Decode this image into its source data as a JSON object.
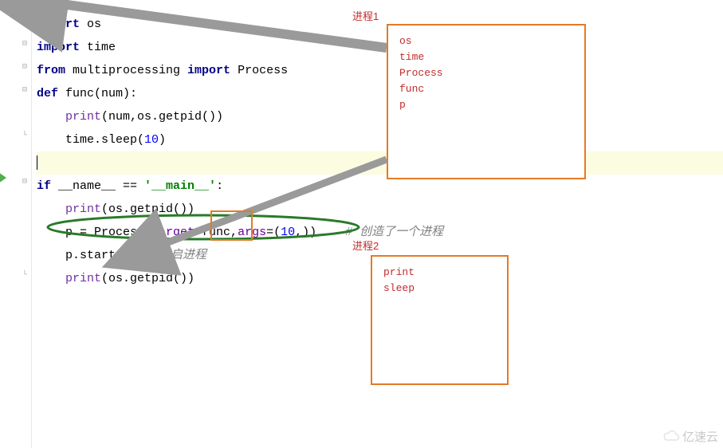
{
  "code": {
    "l1a": "import",
    "l1b": " os",
    "l2a": "import",
    "l2b": " time",
    "l3a": "from",
    "l3b": " multiprocessing ",
    "l3c": "import",
    "l3d": " Process",
    "l4a": "def",
    "l4b": " func(num):",
    "l5a": "    ",
    "l5b": "print",
    "l5c": "(num,os.getpid())",
    "l6a": "    time.sleep(",
    "l6b": "10",
    "l6c": ")",
    "l8a": "if",
    "l8b": " __name__ == ",
    "l8c": "'__main__'",
    "l8d": ":",
    "l9a": "    ",
    "l9b": "print",
    "l9c": "(os.getpid())",
    "l10a": "    p = Process(",
    "l10b": "target",
    "l10c": "=func,",
    "l10d": "args",
    "l10e": "=(",
    "l10f": "10",
    "l10g": ",))    ",
    "l10h": "# 创造了一个进程",
    "l11a": "    p.start()  ",
    "l11b": "# 开启进程",
    "l12a": "    ",
    "l12b": "print",
    "l12c": "(os.getpid())"
  },
  "box1": {
    "label": "进程1",
    "i1": "os",
    "i2": "time",
    "i3": "Process",
    "i4": "func",
    "i5": "p"
  },
  "box2": {
    "label": "进程2",
    "i1": "print",
    "i2": "sleep"
  },
  "watermark": "亿速云"
}
